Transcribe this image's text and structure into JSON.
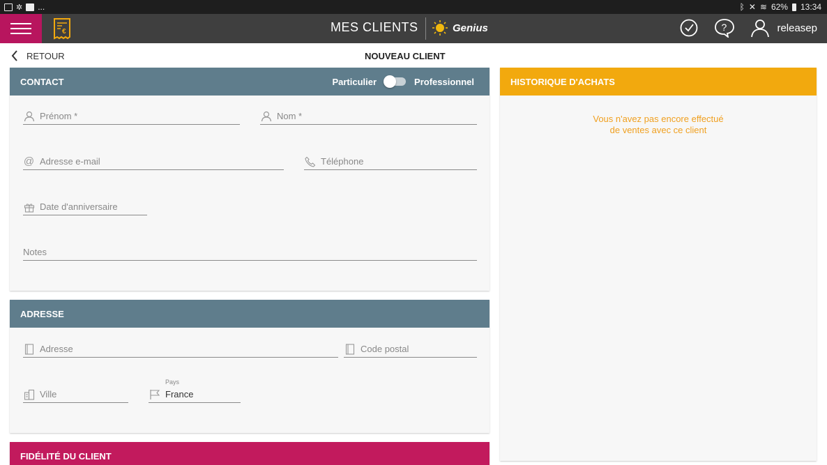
{
  "status_bar": {
    "icons": [
      "image-icon",
      "settings-icon",
      "flipboard-icon"
    ],
    "more": "...",
    "battery": "62%",
    "time": "13:34"
  },
  "app_bar": {
    "title": "MES CLIENTS",
    "brand": "Genius",
    "user": "releasep",
    "menu_color": "#b8155e"
  },
  "sub_header": {
    "back_label": "RETOUR",
    "page_title": "NOUVEAU CLIENT"
  },
  "contact": {
    "title": "CONTACT",
    "toggle_left": "Particulier",
    "toggle_right": "Professionnel",
    "toggle_on": false,
    "fields": {
      "prenom": "Prénom *",
      "nom": "Nom *",
      "email": "Adresse e-mail",
      "telephone": "Téléphone",
      "anniversaire": "Date d'anniversaire",
      "notes": "Notes"
    }
  },
  "adresse": {
    "title": "ADRESSE",
    "fields": {
      "adresse": "Adresse",
      "code_postal": "Code postal",
      "ville": "Ville",
      "pays_label": "Pays",
      "pays_value": "France"
    }
  },
  "fidelite": {
    "title": "FIDÉLITÉ DU CLIENT"
  },
  "historique": {
    "title": "HISTORIQUE D'ACHATS",
    "empty_line1": "Vous n'avez pas encore effectué",
    "empty_line2": "de ventes avec ce client"
  },
  "colors": {
    "section_header": "#5f7d8c",
    "history_header": "#f2a90e",
    "loyalty_header": "#c21a5d",
    "app_bar": "#3f3f3f"
  }
}
